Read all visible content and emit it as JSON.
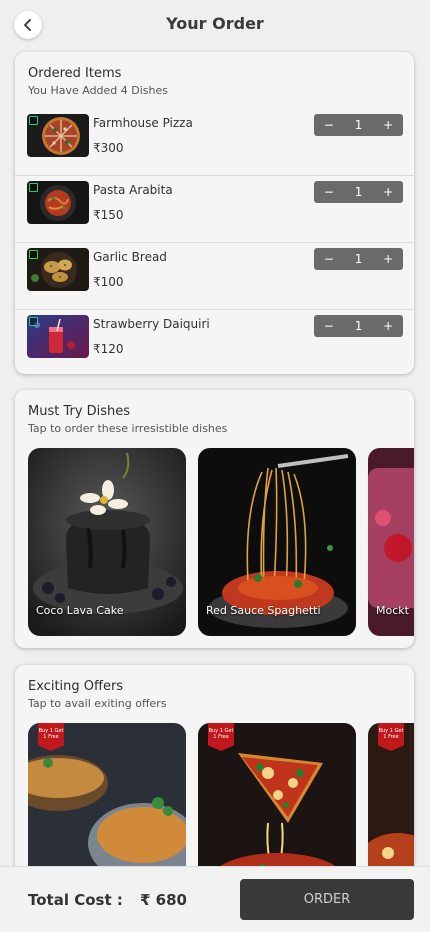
{
  "header": {
    "title": "Your Order"
  },
  "ordered": {
    "title": "Ordered Items",
    "subtitle": "You Have Added 4 Dishes",
    "items": [
      {
        "name": "Farmhouse Pizza",
        "price": "₹300",
        "qty": "1"
      },
      {
        "name": "Pasta Arabita",
        "price": "₹150",
        "qty": "1"
      },
      {
        "name": "Garlic Bread",
        "price": "₹100",
        "qty": "1"
      },
      {
        "name": "Strawberry Daiquiri",
        "price": "₹120",
        "qty": "1"
      }
    ],
    "minus": "−",
    "plus": "+"
  },
  "must_try": {
    "title": "Must Try Dishes",
    "subtitle": "Tap to order these irresistible dishes",
    "dishes": [
      {
        "label": "Coco Lava Cake"
      },
      {
        "label": "Red Sauce Spaghetti"
      },
      {
        "label": "Mockt"
      }
    ]
  },
  "offers": {
    "title": "Exciting Offers",
    "subtitle": "Tap to avail exiting offers",
    "badge": "Buy 1 Get 1 Free"
  },
  "footer": {
    "total_label": "Total Cost :",
    "total_value": "₹ 680",
    "order_label": "ORDER"
  },
  "colors": {
    "background": "#efefef",
    "stepper": "#6a6a6a",
    "order_button": "#3a3a3a",
    "veg_mark": "#2ecc71",
    "offer_badge": "#c0181d"
  },
  "icons": {
    "back": "chevron-left-icon",
    "veg": "veg-indicator-icon"
  }
}
